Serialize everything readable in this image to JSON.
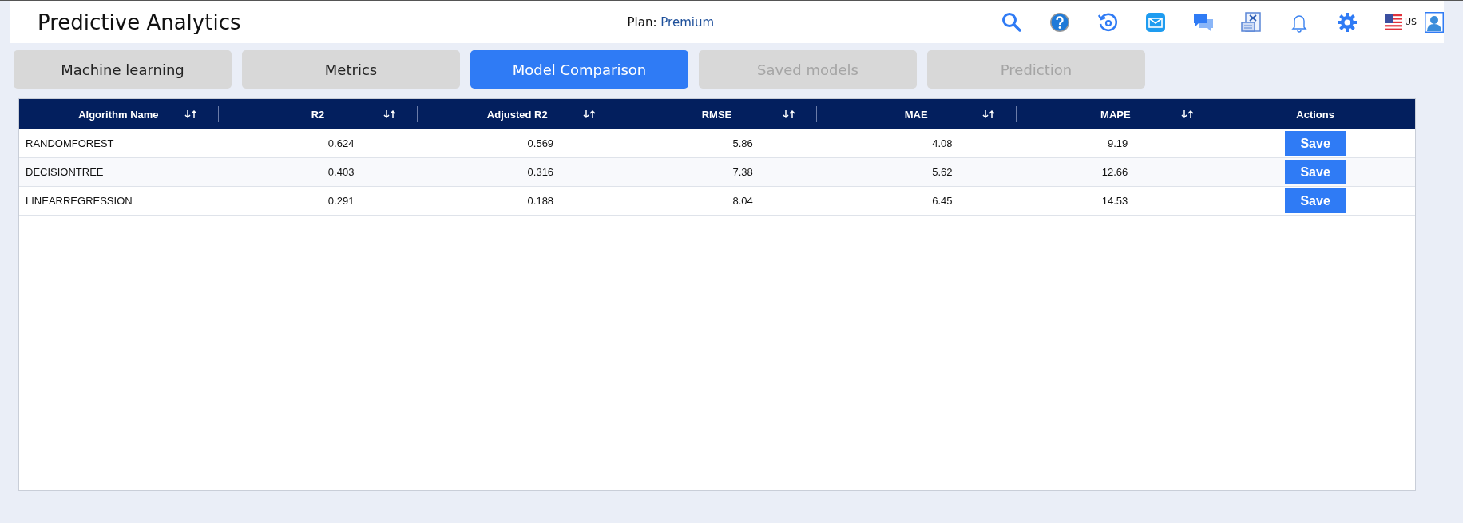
{
  "header": {
    "title": "Predictive Analytics",
    "plan_label": "Plan:",
    "plan_value": "Premium",
    "locale": "US"
  },
  "tabs": [
    {
      "label": "Machine learning",
      "selected": false,
      "disabled": false
    },
    {
      "label": "Metrics",
      "selected": false,
      "disabled": false
    },
    {
      "label": "Model Comparison",
      "selected": true,
      "disabled": false
    },
    {
      "label": "Saved models",
      "selected": false,
      "disabled": true
    },
    {
      "label": "Prediction",
      "selected": false,
      "disabled": true
    }
  ],
  "table": {
    "columns": [
      {
        "label": "Algorithm Name",
        "sortable": true
      },
      {
        "label": "R2",
        "sortable": true
      },
      {
        "label": "Adjusted R2",
        "sortable": true
      },
      {
        "label": "RMSE",
        "sortable": true
      },
      {
        "label": "MAE",
        "sortable": true
      },
      {
        "label": "MAPE",
        "sortable": true
      },
      {
        "label": "Actions",
        "sortable": false
      }
    ],
    "rows": [
      {
        "cells": [
          "RANDOMFOREST",
          "0.624",
          "0.569",
          "5.86",
          "4.08",
          "9.19"
        ],
        "action": "Save"
      },
      {
        "cells": [
          "DECISIONTREE",
          "0.403",
          "0.316",
          "7.38",
          "5.62",
          "12.66"
        ],
        "action": "Save"
      },
      {
        "cells": [
          "LINEARREGRESSION",
          "0.291",
          "0.188",
          "8.04",
          "6.45",
          "14.53"
        ],
        "action": "Save"
      }
    ]
  }
}
